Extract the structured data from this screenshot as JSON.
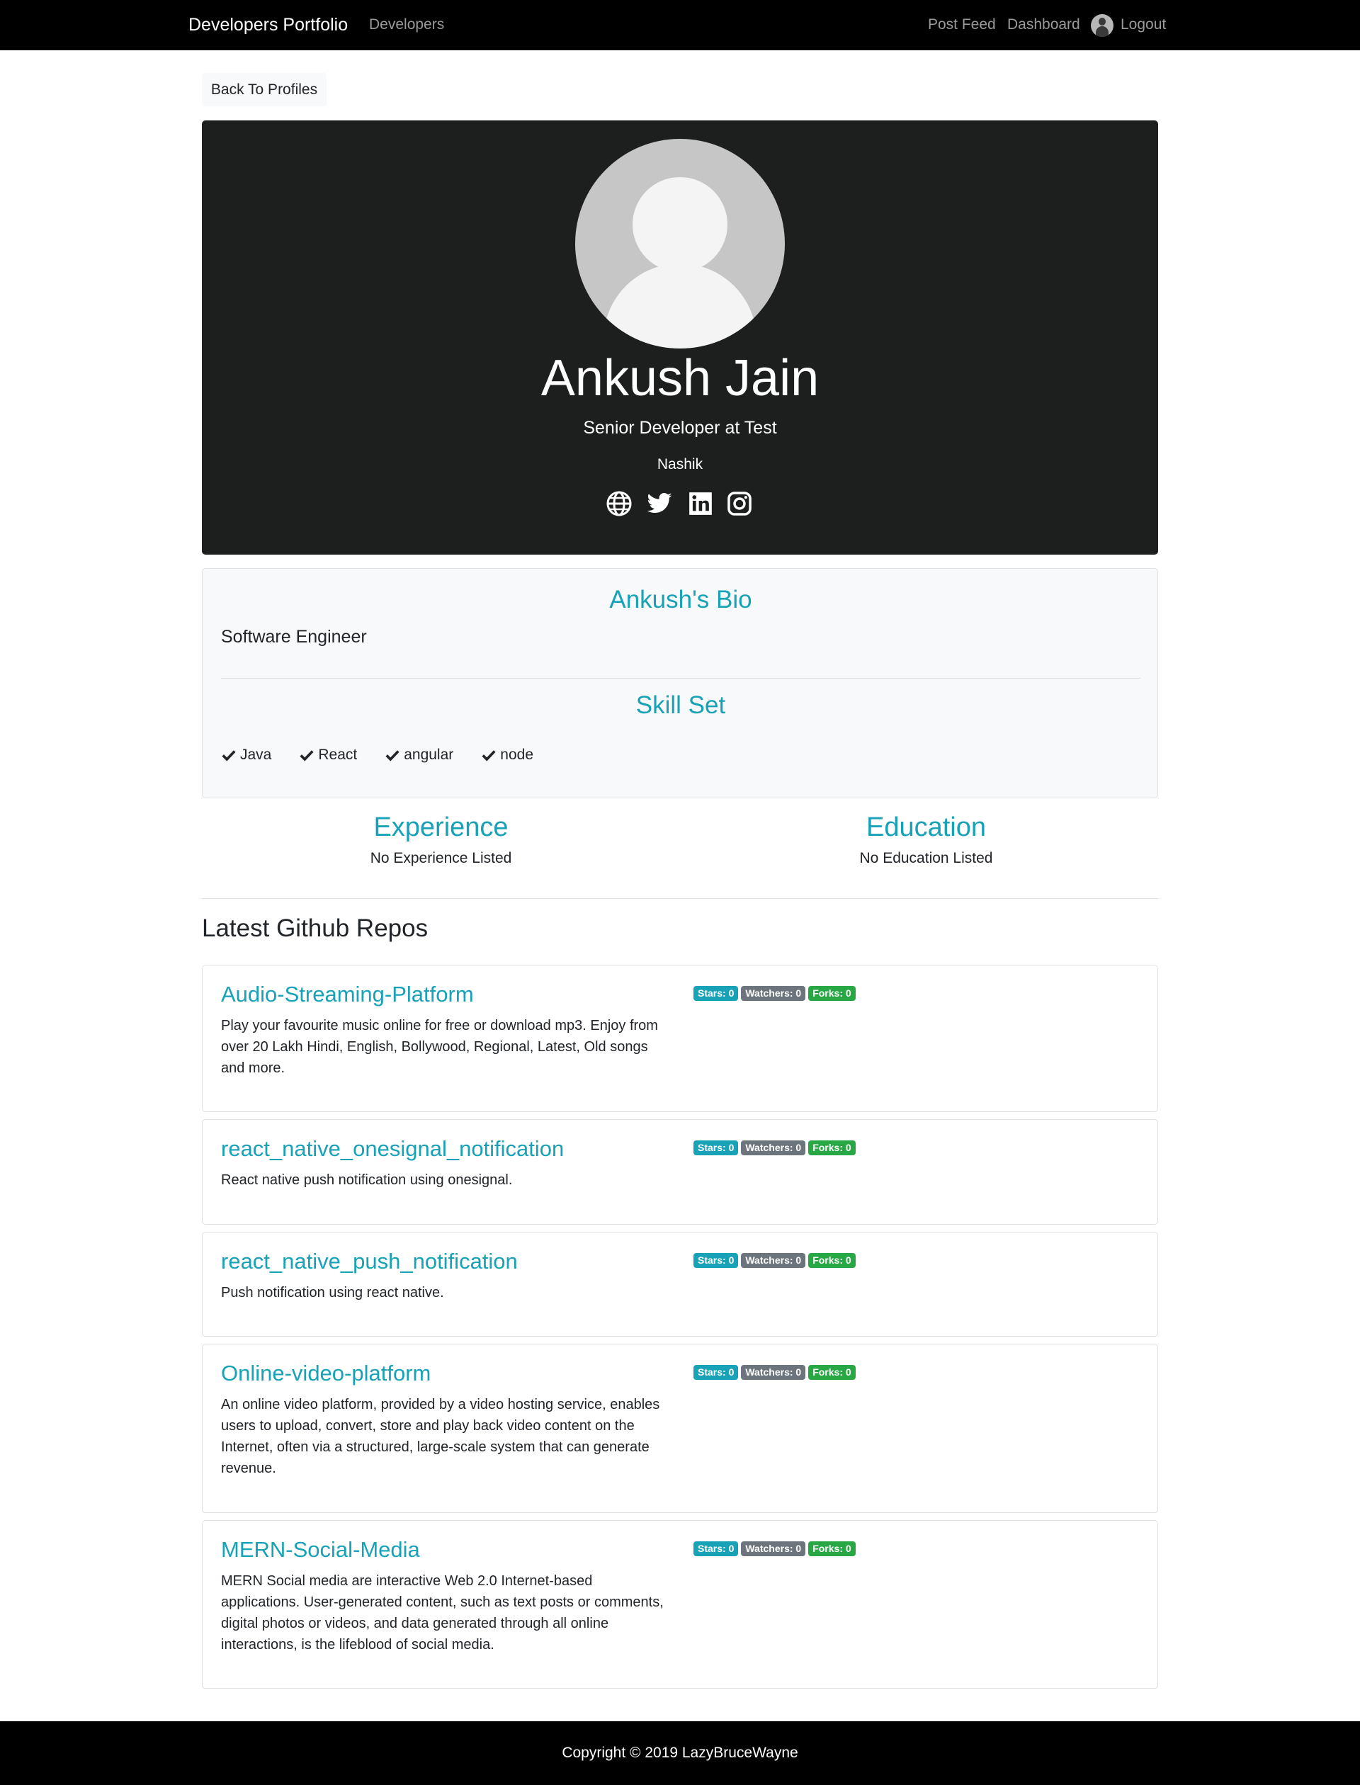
{
  "navbar": {
    "brand": "Developers Portfolio",
    "developers": "Developers",
    "post_feed": "Post Feed",
    "dashboard": "Dashboard",
    "logout": "Logout"
  },
  "back_button": "Back To Profiles",
  "profile": {
    "name": "Ankush Jain",
    "title": "Senior Developer at Test",
    "location": "Nashik",
    "social_icons": [
      "globe-icon",
      "twitter-icon",
      "linkedin-icon",
      "instagram-icon"
    ]
  },
  "bio": {
    "heading": "Ankush's Bio",
    "text": "Software Engineer",
    "skills_heading": "Skill Set",
    "skills": [
      "Java",
      "React",
      "angular",
      "node"
    ]
  },
  "experience": {
    "heading": "Experience",
    "empty": "No Experience Listed"
  },
  "education": {
    "heading": "Education",
    "empty": "No Education Listed"
  },
  "repos_heading": "Latest Github Repos",
  "repos": [
    {
      "name": "Audio-Streaming-Platform",
      "description": "Play your favourite music online for free or download mp3. Enjoy from over 20 Lakh Hindi, English, Bollywood, Regional, Latest, Old songs and more.",
      "stars": "Stars: 0",
      "watchers": "Watchers: 0",
      "forks": "Forks: 0"
    },
    {
      "name": "react_native_onesignal_notification",
      "description": "React native push notification using onesignal.",
      "stars": "Stars: 0",
      "watchers": "Watchers: 0",
      "forks": "Forks: 0"
    },
    {
      "name": "react_native_push_notification",
      "description": "Push notification using react native.",
      "stars": "Stars: 0",
      "watchers": "Watchers: 0",
      "forks": "Forks: 0"
    },
    {
      "name": "Online-video-platform",
      "description": "An online video platform, provided by a video hosting service, enables users to upload, convert, store and play back video content on the Internet, often via a structured, large-scale system that can generate revenue.",
      "stars": "Stars: 0",
      "watchers": "Watchers: 0",
      "forks": "Forks: 0"
    },
    {
      "name": "MERN-Social-Media",
      "description": "MERN Social media are interactive Web 2.0 Internet-based applications. User-generated content, such as text posts or comments, digital photos or videos, and data generated through all online interactions, is the lifeblood of social media.",
      "stars": "Stars: 0",
      "watchers": "Watchers: 0",
      "forks": "Forks: 0"
    }
  ],
  "footer": "Copyright © 2019 LazyBruceWayne",
  "colors": {
    "accent": "#17a2b8",
    "stars_badge": "#17a2b8",
    "watchers_badge": "#6c757d",
    "forks_badge": "#28a745",
    "header_bg": "#1d1e1e",
    "navbar_bg": "#000000"
  }
}
